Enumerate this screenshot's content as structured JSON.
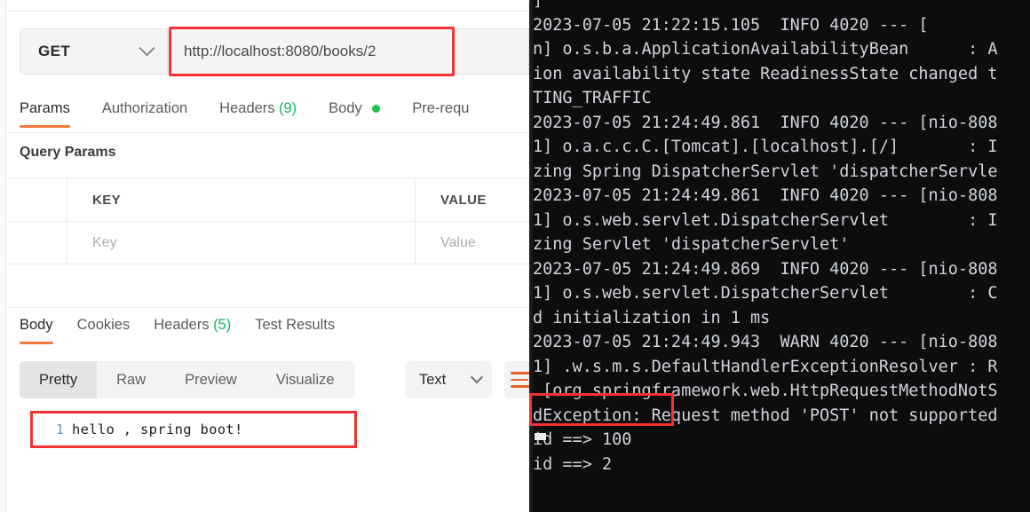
{
  "app": {
    "left_panel": "postman-request-builder",
    "right_panel": "terminal-console"
  },
  "request": {
    "method": "GET",
    "url": "http://localhost:8080/books/2",
    "method_caret": "chevron-down-icon"
  },
  "request_tabs": [
    {
      "label": "Params",
      "active": true,
      "badge": "",
      "dot": false
    },
    {
      "label": "Authorization",
      "active": false,
      "badge": "",
      "dot": false
    },
    {
      "label": "Headers",
      "active": false,
      "badge": "(9)",
      "dot": false
    },
    {
      "label": "Body",
      "active": false,
      "badge": "",
      "dot": true
    },
    {
      "label": "Pre-requ",
      "active": false,
      "badge": "",
      "dot": false
    }
  ],
  "params": {
    "section_title": "Query Params",
    "columns": [
      "",
      "KEY",
      "VALUE"
    ],
    "rows": [
      {
        "key_placeholder": "Key",
        "value_placeholder": "Value"
      }
    ]
  },
  "response_tabs": [
    {
      "label": "Body",
      "active": true,
      "badge": ""
    },
    {
      "label": "Cookies",
      "active": false,
      "badge": ""
    },
    {
      "label": "Headers",
      "active": false,
      "badge": "(5)"
    },
    {
      "label": "Test Results",
      "active": false,
      "badge": ""
    }
  ],
  "format_toolbar": {
    "buttons": [
      {
        "label": "Pretty",
        "active": true
      },
      {
        "label": "Raw",
        "active": false
      },
      {
        "label": "Preview",
        "active": false
      },
      {
        "label": "Visualize",
        "active": false
      }
    ],
    "type_select": {
      "value": "Text",
      "caret": "chevron-down-icon"
    },
    "wrap_icon": "wrap-lines-icon"
  },
  "response_body": {
    "line_number": "1",
    "content": "hello , spring boot!"
  },
  "console": {
    "lines": [
      "]",
      "2023-07-05 21:22:15.105  INFO 4020 --- [",
      "n] o.s.b.a.ApplicationAvailabilityBean      : A",
      "ion availability state ReadinessState changed t",
      "TING_TRAFFIC",
      "2023-07-05 21:24:49.861  INFO 4020 --- [nio-808",
      "1] o.a.c.c.C.[Tomcat].[localhost].[/]       : I",
      "zing Spring DispatcherServlet 'dispatcherServle",
      "2023-07-05 21:24:49.861  INFO 4020 --- [nio-808",
      "1] o.s.web.servlet.DispatcherServlet        : I",
      "zing Servlet 'dispatcherServlet'",
      "2023-07-05 21:24:49.869  INFO 4020 --- [nio-808",
      "1] o.s.web.servlet.DispatcherServlet        : C",
      "d initialization in 1 ms",
      "2023-07-05 21:24:49.943  WARN 4020 --- [nio-808",
      "1] .w.s.m.s.DefaultHandlerExceptionResolver : R",
      " [org.springframework.web.HttpRequestMethodNotS",
      "dException: Request method 'POST' not supported",
      "id ==> 100",
      "id ==> 2"
    ],
    "cursor": "block-cursor"
  },
  "highlights": {
    "url_box": {
      "color": "#f4322f",
      "target": "url-input"
    },
    "response_body": {
      "color": "#f4322f",
      "target": "response-body-line"
    },
    "console_id": {
      "color": "#f4322f",
      "target": "console-id-line"
    }
  }
}
